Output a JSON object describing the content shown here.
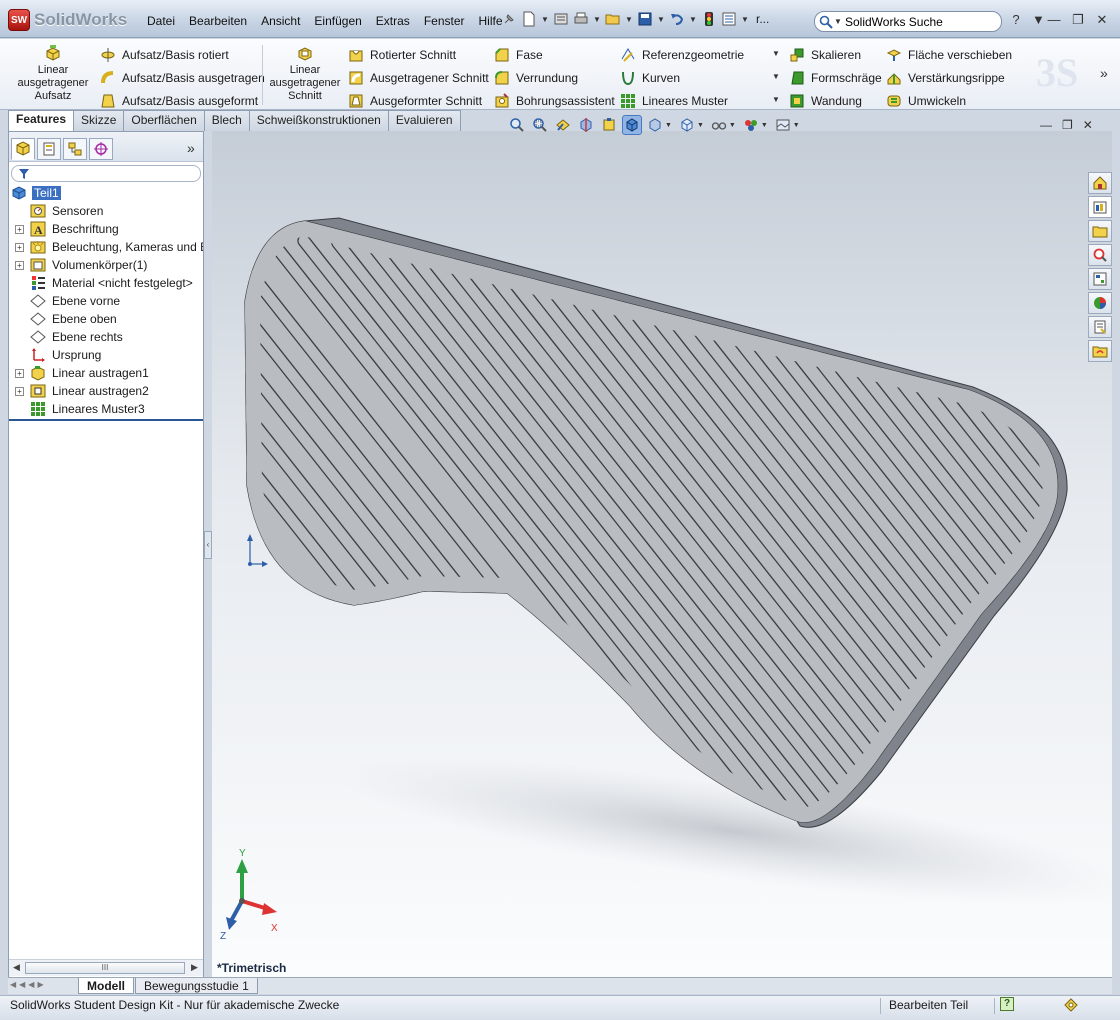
{
  "app": {
    "logo_text": "SolidWorks",
    "logo_badge": "SW"
  },
  "menu": [
    "Datei",
    "Bearbeiten",
    "Ansicht",
    "Einfügen",
    "Extras",
    "Fenster",
    "Hilfe"
  ],
  "quick_access": {
    "truncated_label": "r..."
  },
  "search": {
    "value": "SolidWorks Suche"
  },
  "window_controls": {
    "help": "?",
    "minimize": "—",
    "restore": "❐",
    "close": "✕"
  },
  "command_manager": {
    "big_buttons": [
      {
        "label": "Linear ausgetragener Aufsatz"
      },
      {
        "label": "Linear ausgetragener Schnitt"
      }
    ],
    "col1": [
      "Aufsatz/Basis rotiert",
      "Aufsatz/Basis ausgetragen",
      "Aufsatz/Basis ausgeformt"
    ],
    "col2": [
      "Rotierter Schnitt",
      "Ausgetragener Schnitt",
      "Ausgeformter Schnitt"
    ],
    "col3": [
      "Fase",
      "Verrundung",
      "Bohrungsassistent"
    ],
    "col4": [
      "Referenzgeometrie",
      "Kurven",
      "Lineares Muster"
    ],
    "col5": [
      "Skalieren",
      "Formschräge",
      "Wandung"
    ],
    "col6": [
      "Fläche verschieben",
      "Verstärkungsrippe",
      "Umwickeln"
    ],
    "more": "»"
  },
  "tabs": [
    {
      "label": "Features",
      "active": true
    },
    {
      "label": "Skizze"
    },
    {
      "label": "Oberflächen"
    },
    {
      "label": "Blech"
    },
    {
      "label": "Schweißkonstruktionen"
    },
    {
      "label": "Evaluieren"
    }
  ],
  "feature_tree": {
    "expand_panel": "»",
    "root": "Teil1",
    "items": [
      {
        "label": "Sensoren",
        "expandable": false
      },
      {
        "label": "Beschriftung",
        "expandable": true
      },
      {
        "label": "Beleuchtung, Kameras und B",
        "expandable": true
      },
      {
        "label": "Volumenkörper(1)",
        "expandable": true
      },
      {
        "label": "Material <nicht festgelegt>",
        "expandable": false
      },
      {
        "label": "Ebene vorne",
        "expandable": false
      },
      {
        "label": "Ebene oben",
        "expandable": false
      },
      {
        "label": "Ebene rechts",
        "expandable": false
      },
      {
        "label": "Ursprung",
        "expandable": false
      },
      {
        "label": "Linear austragen1",
        "expandable": true
      },
      {
        "label": "Linear austragen2",
        "expandable": true
      },
      {
        "label": "Lineares Muster3",
        "expandable": false
      }
    ],
    "scroll_thumb": "III"
  },
  "graphics": {
    "view_name": "*Trimetrisch",
    "triad": {
      "x": "X",
      "y": "Y",
      "z": "Z"
    },
    "colors": {
      "part_face": "#b9bcc1",
      "part_edge": "#3a3d42",
      "part_side": "#7f848c",
      "slot_shadow": "#8b8f96"
    }
  },
  "bottom_tabs": [
    {
      "label": "Modell",
      "active": true
    },
    {
      "label": "Bewegungsstudie 1"
    }
  ],
  "status": {
    "message": "SolidWorks Student Design Kit - Nur für akademische Zwecke",
    "mode": "Bearbeiten Teil",
    "help_icon": "?"
  }
}
